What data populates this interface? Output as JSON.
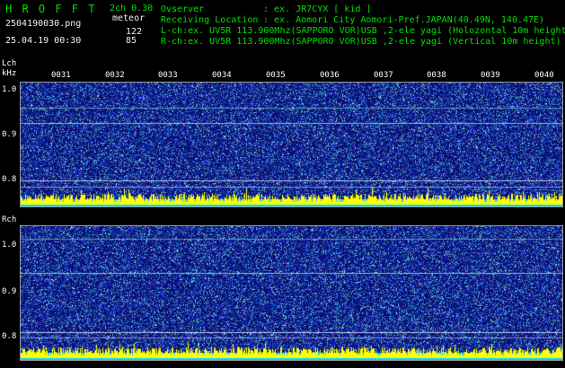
{
  "header": {
    "brand": "H R O F F T",
    "channels": "2ch 0.30",
    "mode": "meteor",
    "filename": "2504190030.png",
    "timestamp": "25.04.19 00:30",
    "count_l": "122",
    "count_r": "85",
    "observer_label": "Ovserver",
    "observer_value": ": ex. JR7CYX [ kid ]",
    "location_label": "Receiving Location",
    "location_value": ": ex. Aomori City Aomori-Pref.JAPAN(40.49N, 140.47E)",
    "lch_info": "L-ch:ex. UV5R 113.900Mhz(SAPPORO VOR)USB ,2-ele yagi (Holozontal 10m height)",
    "rch_info": "R-ch:ex. UV5R 113.900Mhz(SAPPORO VOR)USB ,2-ele yagi (Vertical 10m height)"
  },
  "left_panel": {
    "channel_label": "Lch",
    "unit_label": "kHz",
    "y_ticks": [
      "1.0",
      "0.9",
      "0.8"
    ],
    "time_ticks": [
      "0031",
      "0032",
      "0033",
      "0034",
      "0035",
      "0036",
      "0037",
      "0038",
      "0039",
      "0040"
    ]
  },
  "right_panel": {
    "channel_label": "Rch",
    "y_ticks": [
      "1.0",
      "0.9",
      "0.8"
    ]
  },
  "colors": {
    "header_text": "#00e000",
    "axis_text": "#ffffff",
    "background": "#000000",
    "spectrogram_base": "#0b0b6a",
    "carrier_line": "#7fd6c8",
    "activity_bar": "#ffff00",
    "activity_floor": "#00d8ff"
  },
  "spectrogram_levels": {
    "top_carrier_freq_khz": 0.93,
    "upper_faint_freq_khz": 0.97,
    "lower_line_freq_khz": 0.79
  }
}
